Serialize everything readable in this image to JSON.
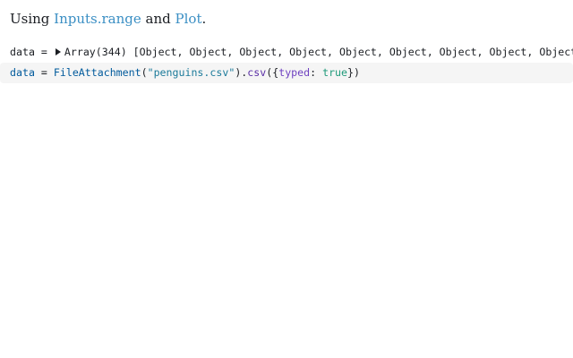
{
  "intro": {
    "prefix": "Using ",
    "link1": "Inputs.range",
    "middle": " and ",
    "link2": "Plot",
    "suffix": "."
  },
  "output": {
    "name": "data",
    "equals": " = ",
    "summary": "Array(344) [Object, Object, Object, Object, Object, Object, Object, Object, Object, Obje"
  },
  "code": {
    "var": "data",
    "assign": " = ",
    "fn": "FileAttachment",
    "open_paren": "(",
    "arg": "\"penguins.csv\"",
    "close_paren": ").",
    "method": "csv",
    "open_obj": "({",
    "key": "typed",
    "colon": ": ",
    "value": "true",
    "close_obj": "})"
  },
  "colors": {
    "link": "#3b8fc4",
    "cell_background": "#f5f5f5"
  }
}
